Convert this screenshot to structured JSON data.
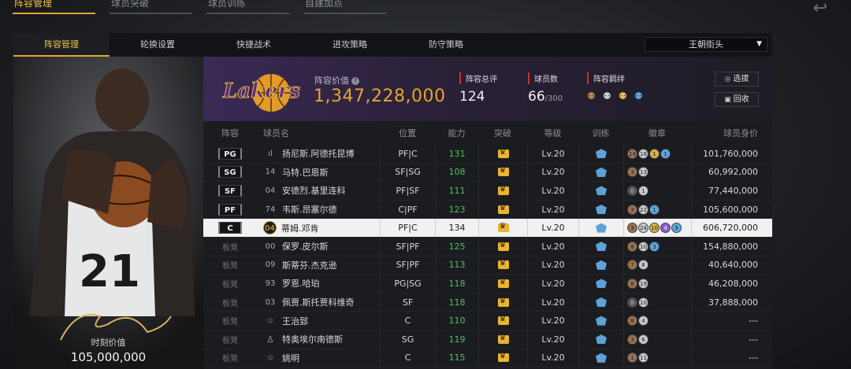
{
  "top_tabs": [
    "阵容管理",
    "球员突破",
    "球员训练",
    "自建加点"
  ],
  "sub_tabs": [
    "阵容管理",
    "轮换设置",
    "快捷战术",
    "进攻策略",
    "防守策略"
  ],
  "team_select": "王朝街头",
  "card": {
    "number": "21",
    "label": "时刻价值",
    "value": "105,000,000"
  },
  "summary": {
    "logo_text": "Lakers",
    "value_label": "阵容价值",
    "value": "1,347,228,000",
    "rating_label": "阵容总评",
    "rating": "124",
    "players_label": "球员数",
    "players": "66",
    "players_max": "/300",
    "bond_label": "阵容羁绊",
    "btn_select": "选拔",
    "btn_recycle": "回收"
  },
  "columns": {
    "lineup": "阵容",
    "name": "球员名",
    "position": "位置",
    "ability": "能力",
    "breakthrough": "突破",
    "level": "等级",
    "training": "训练",
    "badges": "徽章",
    "salary": "球员身价"
  },
  "rows": [
    {
      "slot": "PG",
      "starter": true,
      "num": "ıl",
      "name": "扬尼斯.阿德托昆博",
      "pos": "PF|C",
      "rating": "131",
      "level": "Lv.20",
      "badges": [
        [
          "14",
          "bronze"
        ],
        [
          "18",
          "silver"
        ],
        [
          "1",
          "gold"
        ],
        [
          "1",
          "blue"
        ]
      ],
      "salary": "101,760,000"
    },
    {
      "slot": "SG",
      "starter": true,
      "num": "14",
      "name": "马特.巴恩斯",
      "pos": "SF|SG",
      "rating": "108",
      "level": "Lv.20",
      "badges": [
        [
          "3",
          "bronze"
        ],
        [
          "13",
          "silver"
        ]
      ],
      "salary": "60,992,000"
    },
    {
      "slot": "SF",
      "starter": true,
      "num": "04",
      "name": "安德烈.基里连科",
      "pos": "PF|SF",
      "rating": "111",
      "level": "Lv.20",
      "badges": [
        [
          "0",
          "dark"
        ],
        [
          "1",
          "silver"
        ]
      ],
      "salary": "77,440,000"
    },
    {
      "slot": "PF",
      "starter": true,
      "num": "74",
      "name": "韦斯.昂塞尔德",
      "pos": "C|PF",
      "rating": "123",
      "level": "Lv.20",
      "badges": [
        [
          "3",
          "bronze"
        ],
        [
          "22",
          "silver"
        ],
        [
          "1",
          "blue"
        ]
      ],
      "salary": "105,600,000"
    },
    {
      "slot": "C",
      "starter": true,
      "selected": true,
      "num": "04",
      "name": "蒂姆.邓肯",
      "pos": "PF|C",
      "rating": "134",
      "level": "Lv.20",
      "badges": [
        [
          "3",
          "bronze"
        ],
        [
          "24",
          "silver"
        ],
        [
          "10",
          "gold"
        ],
        [
          "4",
          "purple"
        ],
        [
          "3",
          "blue"
        ]
      ],
      "salary": "606,720,000"
    },
    {
      "slot": "板凳",
      "starter": false,
      "num": "00",
      "name": "保罗.皮尔斯",
      "pos": "SF|PF",
      "rating": "125",
      "level": "Lv.20",
      "badges": [
        [
          "8",
          "bronze"
        ],
        [
          "10",
          "silver"
        ],
        [
          "3",
          "blue"
        ]
      ],
      "salary": "154,880,000"
    },
    {
      "slot": "板凳",
      "starter": false,
      "num": "09",
      "name": "斯蒂芬.杰克逊",
      "pos": "SF|PF",
      "rating": "113",
      "level": "Lv.20",
      "badges": [
        [
          "7",
          "bronze"
        ],
        [
          "8",
          "silver"
        ]
      ],
      "salary": "40,640,000"
    },
    {
      "slot": "板凳",
      "starter": false,
      "num": "93",
      "name": "罗恩.哈珀",
      "pos": "PG|SG",
      "rating": "118",
      "level": "Lv.20",
      "badges": [
        [
          "8",
          "bronze"
        ],
        [
          "19",
          "silver"
        ]
      ],
      "salary": "46,208,000"
    },
    {
      "slot": "板凳",
      "starter": false,
      "num": "03",
      "name": "佩贾.斯托贾科维奇",
      "pos": "SF",
      "rating": "118",
      "level": "Lv.20",
      "badges": [
        [
          "0",
          "dark"
        ],
        [
          "10",
          "silver"
        ]
      ],
      "salary": "37,888,000"
    },
    {
      "slot": "板凳",
      "starter": false,
      "num": "☆",
      "name": "王治郅",
      "pos": "C",
      "rating": "110",
      "level": "Lv.20",
      "badges": [
        [
          "8",
          "bronze"
        ],
        [
          "4",
          "silver"
        ]
      ],
      "salary": "---"
    },
    {
      "slot": "板凳",
      "starter": false,
      "num": "♙",
      "name": "特奥埃尔南德斯",
      "pos": "SG",
      "rating": "119",
      "level": "Lv.20",
      "badges": [
        [
          "3",
          "bronze"
        ],
        [
          "6",
          "silver"
        ]
      ],
      "salary": "---"
    },
    {
      "slot": "板凳",
      "starter": false,
      "num": "☆",
      "name": "姚明",
      "pos": "C",
      "rating": "115",
      "level": "Lv.20",
      "badges": [
        [
          "1",
          "bronze"
        ],
        [
          "11",
          "silver"
        ]
      ],
      "salary": "---"
    }
  ],
  "colors": {
    "accent": "#e0a82e",
    "rating_green": "#4cc35b",
    "value_orange": "#e7a52c"
  }
}
